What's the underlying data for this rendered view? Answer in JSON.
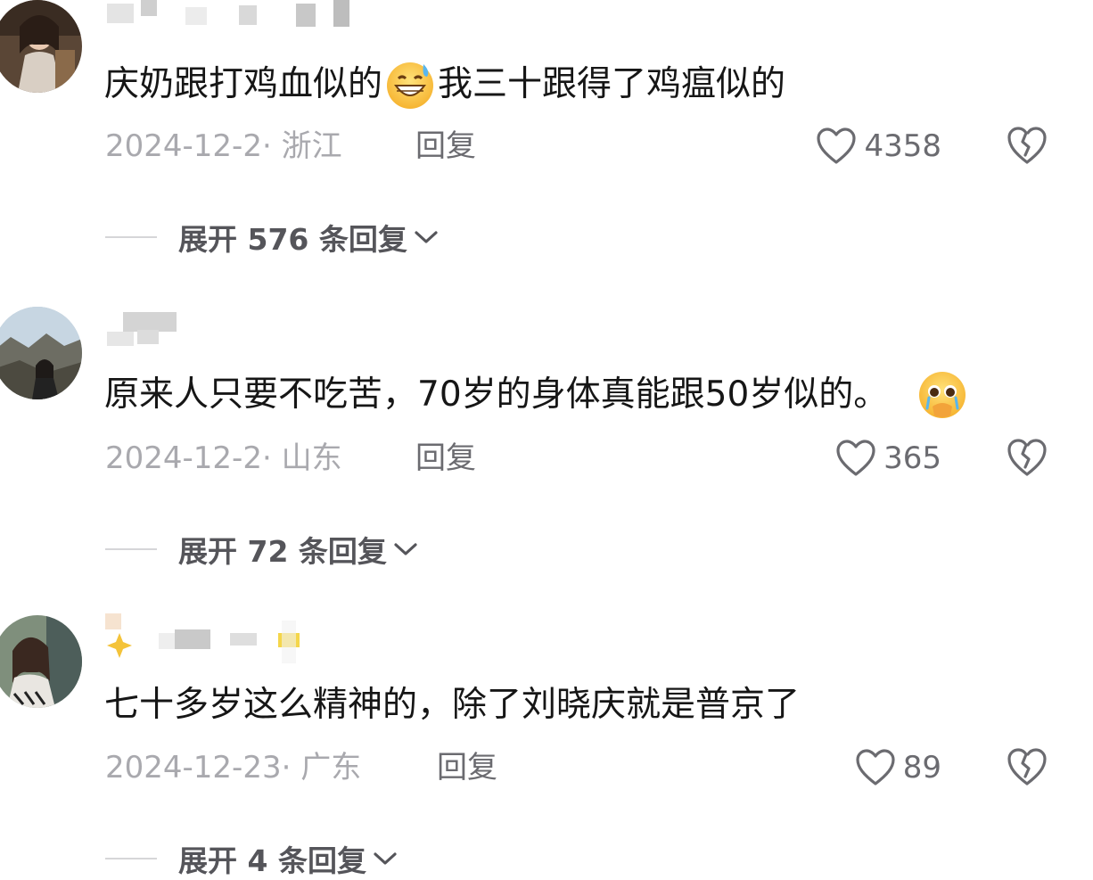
{
  "comments": [
    {
      "text_before": "庆奶跟打鸡血似的",
      "emoji": "grinning-sweat-emoji",
      "text_after": "我三十跟得了鸡瘟似的",
      "meta": "2024-12-2· 浙江",
      "reply_label": "回复",
      "likes": "4358",
      "expand_label": "展开 576 条回复"
    },
    {
      "text_before": "原来人只要不吃苦，70岁的身体真能跟50岁似的。",
      "emoji": "pleading-tears-emoji",
      "text_after": "",
      "meta": "2024-12-2· 山东",
      "reply_label": "回复",
      "likes": "365",
      "expand_label": "展开 72 条回复"
    },
    {
      "text_before": "七十多岁这么精神的，除了刘晓庆就是普京了",
      "emoji": "",
      "text_after": "",
      "meta": "2024-12-23· 广东",
      "reply_label": "回复",
      "likes": "89",
      "expand_label": "展开 4 条回复"
    }
  ],
  "icons": {
    "like": "heart-outline-icon",
    "dislike": "broken-heart-icon",
    "expand": "chevron-down-icon"
  },
  "colors": {
    "text": "#161616",
    "meta": "#a9a9ae",
    "action": "#6b6b70",
    "background": "#ffffff"
  }
}
